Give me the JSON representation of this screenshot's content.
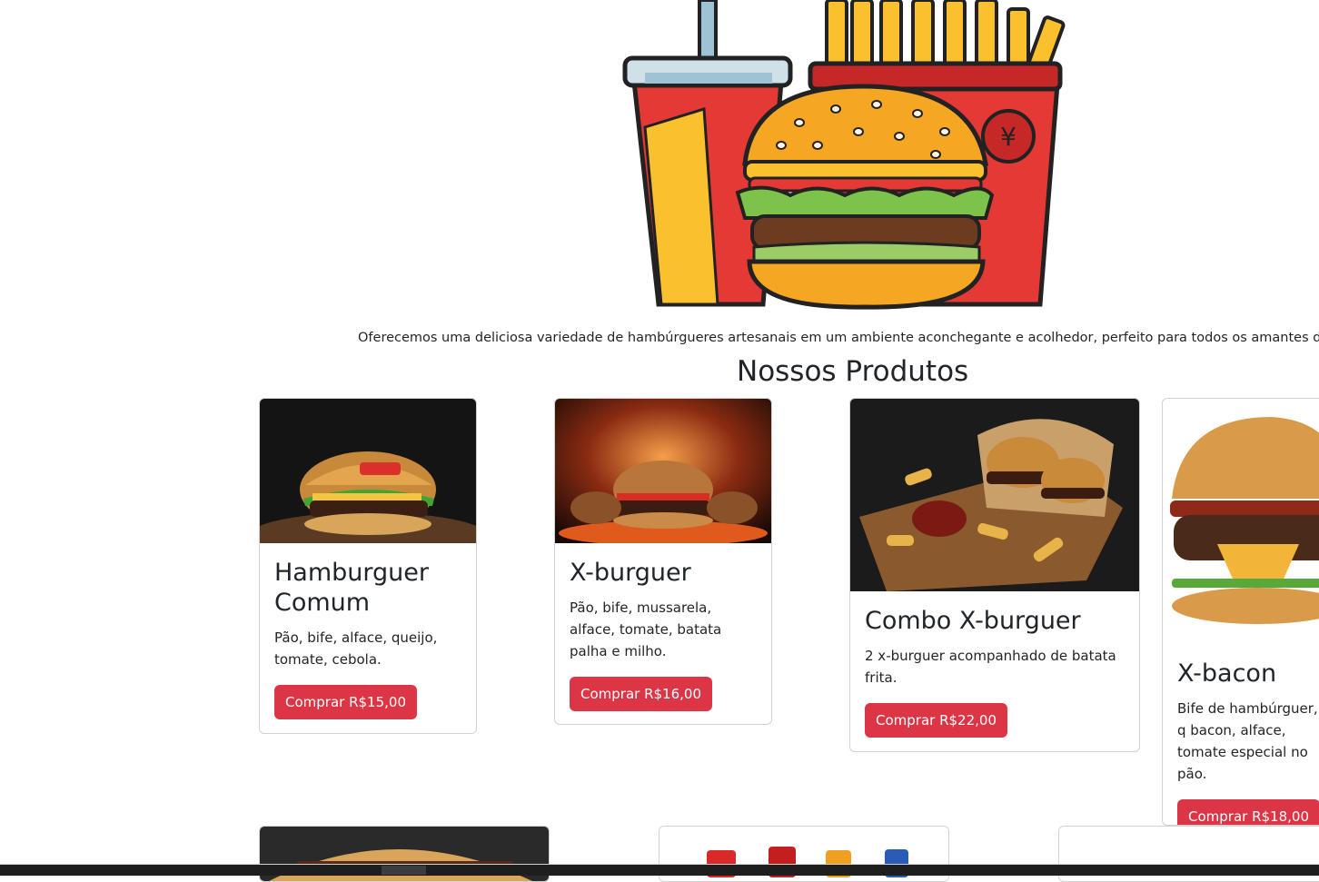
{
  "hero": {
    "image": "burger-fries-soda-illustration",
    "tagline": "Oferecemos uma deliciosa variedade de hambúrgueres artesanais em um ambiente aconchegante e acolhedor, perfeito para todos os amantes de sab"
  },
  "products_section": {
    "title": "Nossos Produtos",
    "items": [
      {
        "name": "Hamburguer Comum",
        "description": "Pão, bife, alface, queijo, tomate, cebola.",
        "button": "Comprar R$15,00",
        "image": "burger-on-board-photo"
      },
      {
        "name": "X-burguer",
        "description": "Pão, bife, mussarela, alface, tomate, batata palha e milho.",
        "button": "Comprar R$16,00",
        "image": "burger-flames-photo"
      },
      {
        "name": "Combo X-burguer",
        "description": "2 x-burguer acompanhado de batata frita.",
        "button": "Comprar R$22,00",
        "image": "burgers-fries-board-photo"
      },
      {
        "name": "X-bacon",
        "description": "Bife de hambúrguer, q bacon, alface, tomate especial no pão.",
        "button": "Comprar R$18,00",
        "image": "bacon-burger-photo"
      }
    ]
  },
  "colors": {
    "accent": "#dc3545",
    "text": "#212529"
  }
}
